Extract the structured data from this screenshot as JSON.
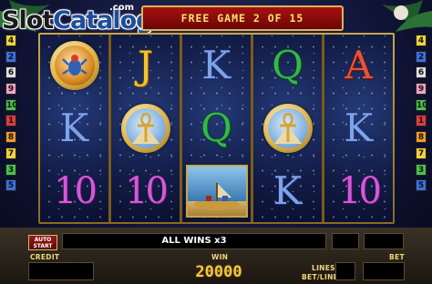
{
  "logo": {
    "main": "Slot",
    "accent": "Catalog",
    "suffix": ".com"
  },
  "banner": {
    "text": "FREE GAME 2 OF 15"
  },
  "paylines_left": [
    {
      "n": "4",
      "color": "#f1d23a"
    },
    {
      "n": "2",
      "color": "#3b6fe0"
    },
    {
      "n": "6",
      "color": "#e0e0e0"
    },
    {
      "n": "9",
      "color": "#f2a0c8"
    },
    {
      "n": "10",
      "color": "#49c24a"
    },
    {
      "n": "1",
      "color": "#e03a3a"
    },
    {
      "n": "8",
      "color": "#f19a2a"
    },
    {
      "n": "7",
      "color": "#f1d23a"
    },
    {
      "n": "3",
      "color": "#49c24a"
    },
    {
      "n": "5",
      "color": "#3b6fe0"
    }
  ],
  "paylines_right": [
    {
      "n": "4",
      "color": "#f1d23a"
    },
    {
      "n": "2",
      "color": "#3b6fe0"
    },
    {
      "n": "6",
      "color": "#e0e0e0"
    },
    {
      "n": "9",
      "color": "#f2a0c8"
    },
    {
      "n": "10",
      "color": "#49c24a"
    },
    {
      "n": "1",
      "color": "#e03a3a"
    },
    {
      "n": "8",
      "color": "#f19a2a"
    },
    {
      "n": "7",
      "color": "#f1d23a"
    },
    {
      "n": "3",
      "color": "#49c24a"
    },
    {
      "n": "5",
      "color": "#3b6fe0"
    }
  ],
  "reels": [
    [
      {
        "type": "scarab"
      },
      {
        "type": "letter",
        "text": "K"
      },
      {
        "type": "letter",
        "text": "10"
      }
    ],
    [
      {
        "type": "letter",
        "text": "J"
      },
      {
        "type": "ankh"
      },
      {
        "type": "letter",
        "text": "10"
      }
    ],
    [
      {
        "type": "letter",
        "text": "K"
      },
      {
        "type": "letter",
        "text": "Q"
      },
      {
        "type": "boat"
      }
    ],
    [
      {
        "type": "letter",
        "text": "Q"
      },
      {
        "type": "ankh"
      },
      {
        "type": "letter",
        "text": "K"
      }
    ],
    [
      {
        "type": "letter",
        "text": "A"
      },
      {
        "type": "letter",
        "text": "K"
      },
      {
        "type": "letter",
        "text": "10"
      }
    ]
  ],
  "panel": {
    "autostart_line1": "AUTO",
    "autostart_line2": "START",
    "message": "ALL WINS x3",
    "credit_label": "CREDIT",
    "win_label": "WIN",
    "win_value": "20000",
    "lines_label": "LINES",
    "betline_label": "BET/LINE",
    "bet_label": "BET"
  }
}
